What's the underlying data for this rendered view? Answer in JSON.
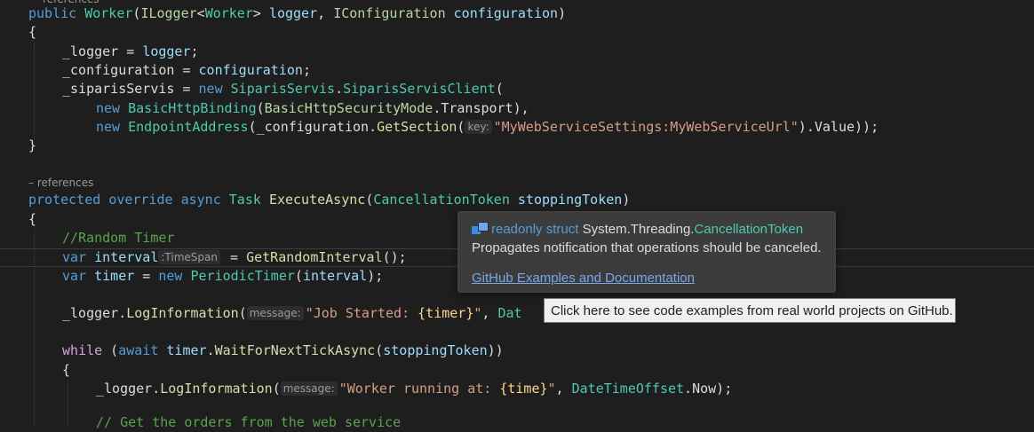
{
  "codelens": {
    "ref1": "references",
    "ref2": "– references"
  },
  "code": {
    "l1": {
      "public": "public",
      "worker": "Worker",
      "p1": "(",
      "ilogger": "ILogger",
      "lt": "<",
      "worker2": "Worker",
      "gt": "> ",
      "logger": "logger",
      "comma": ", ",
      "iconfig": "IConfiguration",
      "sp": " ",
      "configuration": "configuration",
      "close": ")"
    },
    "l2": {
      "brace": "{"
    },
    "l3": {
      "field": "_logger",
      "eq": " = ",
      "val": "logger",
      "semi": ";"
    },
    "l4": {
      "field": "_configuration",
      "eq": " = ",
      "val": "configuration",
      "semi": ";"
    },
    "l5": {
      "field": "_siparisServis",
      "eq": " = ",
      "new": "new",
      "sp": " ",
      "ns": "SiparisServis",
      "dot": ".",
      "cls": "SiparisServisClient",
      "p": "("
    },
    "l6": {
      "new": "new",
      "sp": " ",
      "binding": "BasicHttpBinding",
      "p": "(",
      "mode": "BasicHttpSecurityMode",
      "dot": ".",
      "transport": "Transport",
      "end": "),"
    },
    "l7": {
      "new": "new",
      "sp": " ",
      "endpoint": "EndpointAddress",
      "p": "(",
      "config": "_configuration",
      "dot": ".",
      "getsection": "GetSection",
      "p2": "(",
      "hint": "key:",
      "str": "\"MyWebServiceSettings:MyWebServiceUrl\"",
      "end": ").Value));"
    },
    "l8": {
      "brace": "}"
    },
    "l9": {
      "protected": "protected",
      "override": "override",
      "async": "async",
      "task": "Task",
      "method": "ExecuteAsync",
      "p": "(",
      "ctype": "CancellationToken",
      "param": "stoppingToken",
      "close": ")"
    },
    "l10": {
      "brace": "{"
    },
    "l11": {
      "comment": "//Random Timer"
    },
    "l12": {
      "var": "var",
      "name": "interval",
      "hint": ":TimeSpan",
      "eq": " = ",
      "method": "GetRandomInterval",
      "end": "();"
    },
    "l13": {
      "var": "var",
      "name": "timer",
      "eq": " = ",
      "new": "new",
      "type": "PeriodicTimer",
      "p": "(",
      "arg": "interval",
      "end": ");"
    },
    "l14": {
      "logger": "_logger",
      "dot": ".",
      "method": "LogInformation",
      "p": "(",
      "hint": "message:",
      "str1": "\"Job Started: ",
      "fmt": "{timer}",
      "str2": "\"",
      "comma": ", ",
      "rest": "Dat"
    },
    "l15": {
      "while": "while",
      "sp": " (",
      "await": "await",
      "timer": "timer",
      "dot": ".",
      "method": "WaitForNextTickAsync",
      "p": "(",
      "arg": "stoppingToken",
      "end": "))"
    },
    "l16": {
      "brace": "{"
    },
    "l17": {
      "logger": "_logger",
      "dot": ".",
      "method": "LogInformation",
      "p": "(",
      "hint": "message:",
      "str1": "\"Worker running at: ",
      "fmt": "{time}",
      "str2": "\"",
      "comma": ", ",
      "type": "DateTimeOffset",
      "dot2": ".",
      "now": "Now",
      "end": ");"
    },
    "l18": {
      "comment": "// Get the orders from the web service"
    }
  },
  "quickinfo": {
    "icon": "struct-icon",
    "readonly_struct": "readonly struct",
    "namespace": "System.Threading.",
    "type_name": "CancellationToken",
    "description": "Propagates notification that operations should be canceled.",
    "link": "GitHub Examples and Documentation"
  },
  "tooltip": {
    "text": "Click here to see code examples from real world projects on GitHub."
  },
  "colors": {
    "background": "#1e1e1e",
    "keyword": "#569cd6",
    "type": "#4ec9b0",
    "method": "#dcdcaa",
    "parameter": "#9cdcfe",
    "string": "#d69d85",
    "comment": "#57a64a",
    "control": "#d8a0df"
  }
}
